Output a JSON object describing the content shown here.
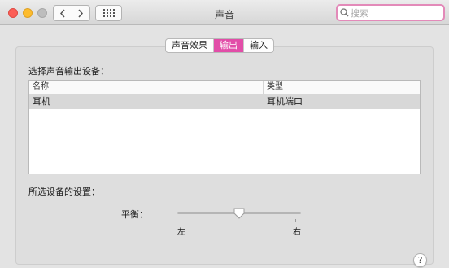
{
  "window": {
    "title": "声音"
  },
  "toolbar": {
    "back_icon": "chevron-left-icon",
    "forward_icon": "chevron-right-icon",
    "grid_icon": "grid-icon",
    "search_placeholder": "搜索"
  },
  "tabs": [
    {
      "label": "声音效果",
      "active": false
    },
    {
      "label": "输出",
      "active": true
    },
    {
      "label": "输入",
      "active": false
    }
  ],
  "output": {
    "select_label": "选择声音输出设备：",
    "table": {
      "columns": [
        "名称",
        "类型"
      ],
      "rows": [
        {
          "name": "耳机",
          "type": "耳机端口",
          "selected": true
        }
      ]
    },
    "settings_label": "所选设备的设置：",
    "balance": {
      "label": "平衡：",
      "left_label": "左",
      "right_label": "右",
      "value": 0.5
    }
  },
  "help": {
    "label": "?"
  },
  "colors": {
    "accent": "#e24da8",
    "search_focus": "#e38ab9"
  }
}
